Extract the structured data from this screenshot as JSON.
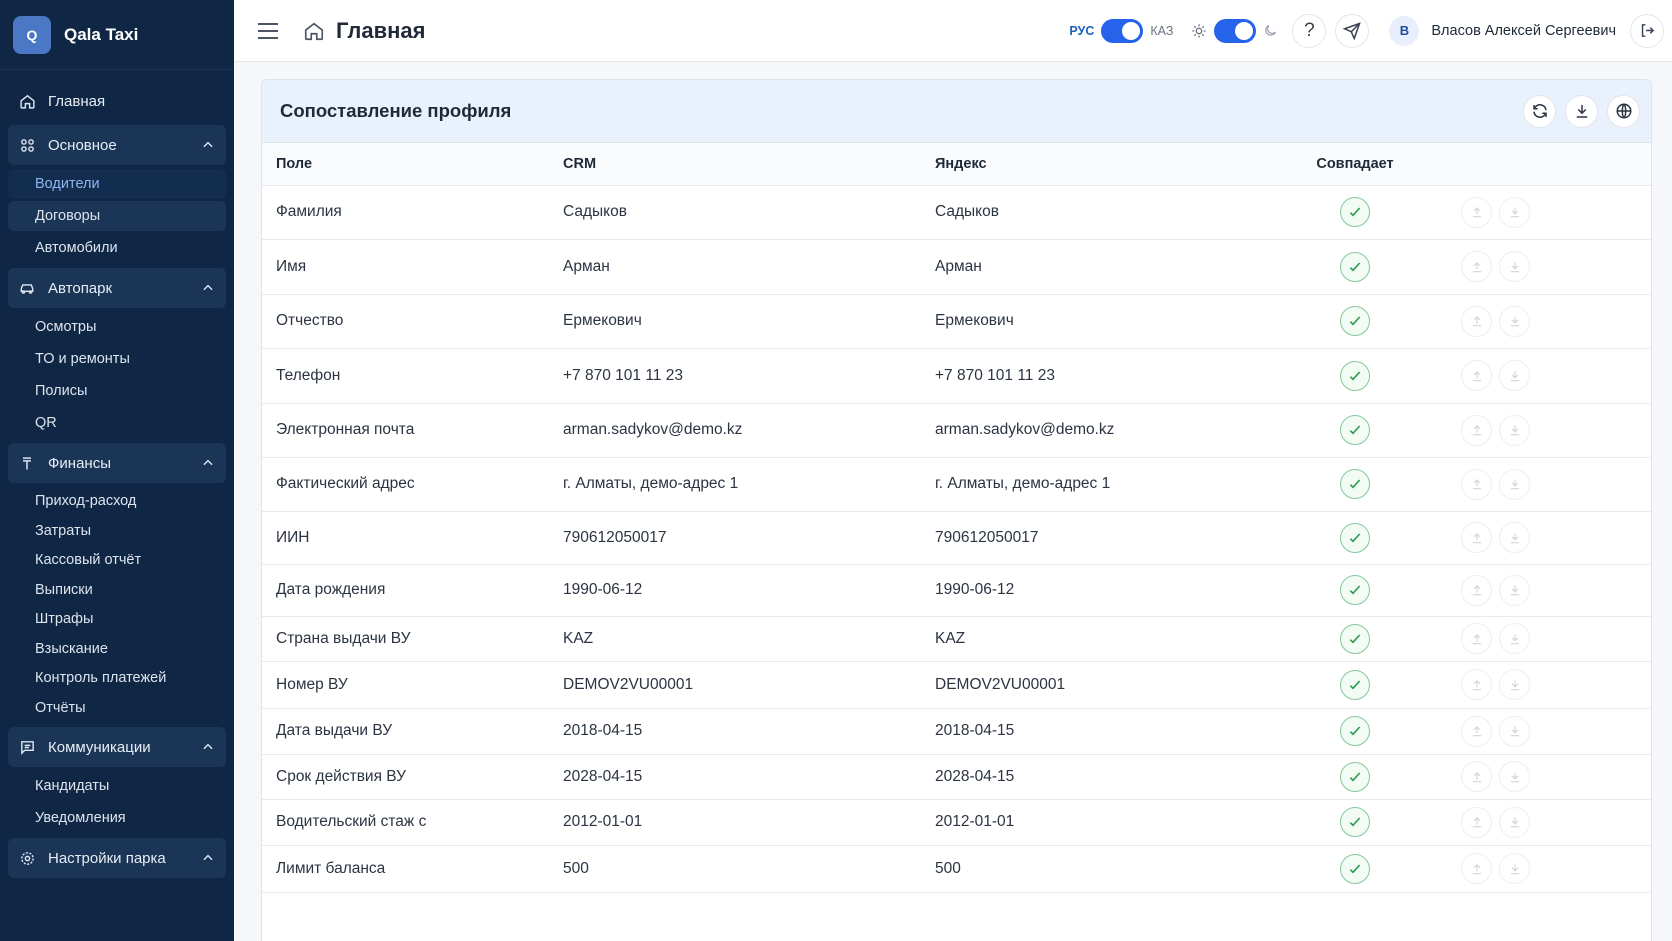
{
  "brand": {
    "logo_letter": "Q",
    "name": "Qala Taxi"
  },
  "sidebar": {
    "home": "Главная",
    "groups": [
      {
        "label": "Основное",
        "icon": "grid-icon",
        "items": [
          "Водители",
          "Договоры",
          "Автомобили"
        ]
      },
      {
        "label": "Автопарк",
        "icon": "car-icon",
        "items": [
          "Осмотры",
          "ТО и ремонты",
          "Полисы",
          "QR"
        ]
      },
      {
        "label": "Финансы",
        "icon": "tenge-icon",
        "items": [
          "Приход-расход",
          "Затраты",
          "Кассовый отчёт",
          "Выписки",
          "Штрафы",
          "Взыскание",
          "Контроль платежей",
          "Отчёты"
        ]
      },
      {
        "label": "Коммуникации",
        "icon": "message-icon",
        "items": [
          "Кандидаты",
          "Уведомления"
        ]
      },
      {
        "label": "Настройки парка",
        "icon": "gear-icon",
        "items": []
      }
    ]
  },
  "topbar": {
    "title": "Главная",
    "lang_active": "РУС",
    "lang_other": "КАЗ",
    "user_initial": "В",
    "user_name": "Власов Алексей Сергеевич"
  },
  "card": {
    "title": "Сопоставление профиля",
    "columns": {
      "field": "Поле",
      "crm": "CRM",
      "yandex": "Яндекс",
      "match": "Совпадает"
    },
    "rows": [
      {
        "field": "Фамилия",
        "crm": "Садыков",
        "yandex": "Садыков",
        "h": 54
      },
      {
        "field": "Имя",
        "crm": "Арман",
        "yandex": "Арман",
        "h": 55
      },
      {
        "field": "Отчество",
        "crm": "Ермекович",
        "yandex": "Ермекович",
        "h": 54
      },
      {
        "field": "Телефон",
        "crm": "+7 870 101 11 23",
        "yandex": "+7 870 101 11 23",
        "h": 55
      },
      {
        "field": "Электронная почта",
        "crm": "arman.sadykov@demo.kz",
        "yandex": "arman.sadykov@demo.kz",
        "h": 54
      },
      {
        "field": "Фактический адрес",
        "crm": "г. Алматы, демо-адрес 1",
        "yandex": "г. Алматы, демо-адрес 1",
        "h": 54
      },
      {
        "field": "ИИН",
        "crm": "790612050017",
        "yandex": "790612050017",
        "h": 53
      },
      {
        "field": "Дата рождения",
        "crm": "1990-06-12",
        "yandex": "1990-06-12",
        "h": 52
      },
      {
        "field": "Страна выдачи ВУ",
        "crm": "KAZ",
        "yandex": "KAZ",
        "h": 45
      },
      {
        "field": "Номер ВУ",
        "crm": "DEMOV2VU00001",
        "yandex": "DEMOV2VU00001",
        "h": 47
      },
      {
        "field": "Дата выдачи ВУ",
        "crm": "2018-04-15",
        "yandex": "2018-04-15",
        "h": 46
      },
      {
        "field": "Срок действия ВУ",
        "crm": "2028-04-15",
        "yandex": "2028-04-15",
        "h": 45
      },
      {
        "field": "Водительский стаж с",
        "crm": "2012-01-01",
        "yandex": "2012-01-01",
        "h": 46
      },
      {
        "field": "Лимит баланса",
        "crm": "500",
        "yandex": "500",
        "h": 47
      }
    ]
  },
  "colors": {
    "sidebar_bg": "#0f2744",
    "accent": "#2563eb",
    "match_green": "#2e9a4f",
    "header_bg": "#e9f1fc"
  }
}
